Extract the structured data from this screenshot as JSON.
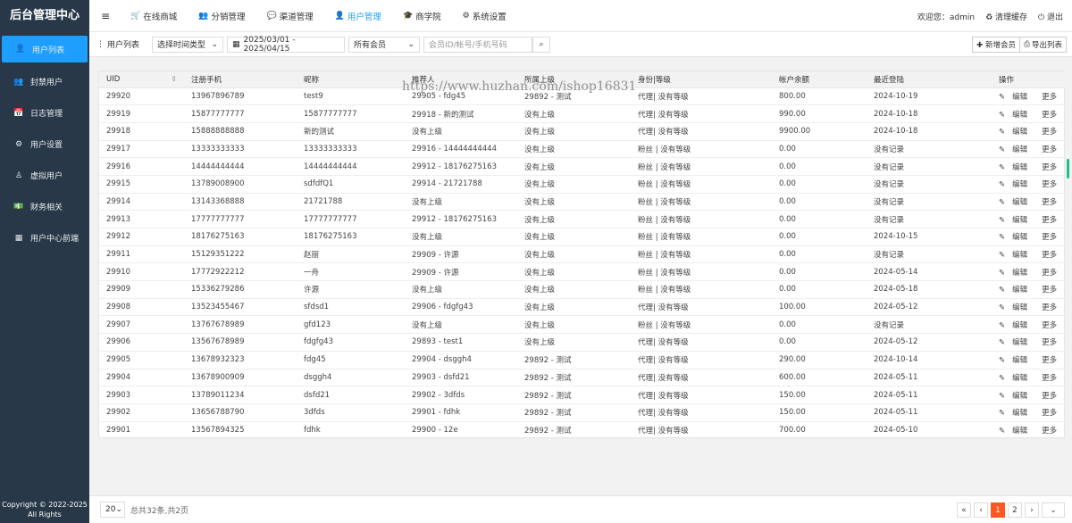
{
  "sidebar": {
    "brand": "后台管理中心",
    "items": [
      {
        "label": "用户列表",
        "icon": "user-icon",
        "glyph": "👤",
        "active": true
      },
      {
        "label": "封禁用户",
        "icon": "users-block-icon",
        "glyph": "👥"
      },
      {
        "label": "日志管理",
        "icon": "calendar-icon",
        "glyph": "📅"
      },
      {
        "label": "用户设置",
        "icon": "gear-icon",
        "glyph": "⚙"
      },
      {
        "label": "虚拟用户",
        "icon": "user-outline-icon",
        "glyph": "♙"
      },
      {
        "label": "财务相关",
        "icon": "money-icon",
        "glyph": "💵"
      },
      {
        "label": "用户中心前端",
        "icon": "grid-icon",
        "glyph": "▦"
      }
    ],
    "copyright_line1": "Copyright © 2022-2025",
    "copyright_line2": "All Rights"
  },
  "topnav": {
    "menu_glyph": "≡",
    "items": [
      {
        "label": "在线商城",
        "icon": "cart-icon",
        "glyph": "🛒"
      },
      {
        "label": "分销管理",
        "icon": "users-icon",
        "glyph": "👥"
      },
      {
        "label": "渠道管理",
        "icon": "chat-icon",
        "glyph": "💬"
      },
      {
        "label": "用户管理",
        "icon": "user-icon",
        "glyph": "👤",
        "active": true
      },
      {
        "label": "商学院",
        "icon": "graduation-cap-icon",
        "glyph": "🎓"
      },
      {
        "label": "系统设置",
        "icon": "gear-icon",
        "glyph": "⚙"
      }
    ],
    "welcome": "欢迎您：admin",
    "clear_cache": "♻ 清理缓存",
    "logout": "⏻ 退出"
  },
  "toolbar": {
    "title": "用户列表",
    "time_type": "选择时间类型",
    "date_range": "2025/03/01 - 2025/04/15",
    "member_type": "所有会员",
    "search_placeholder": "会员ID/帐号/手机号码",
    "add_member": "✚ 新增会员",
    "export": "导出列表"
  },
  "table": {
    "columns": [
      "UID",
      "注册手机",
      "昵称",
      "推荐人",
      "所属上级",
      "身份|等级",
      "帐户余额",
      "最近登陆",
      "操作"
    ],
    "edit_label": "编辑",
    "more_label": "更多",
    "rows": [
      [
        "29920",
        "13967896789",
        "test9",
        "29905 - fdg45",
        "29892 - 测试",
        "代理| 没有等级",
        "800.00",
        "2024-10-19"
      ],
      [
        "29919",
        "15877777777",
        "15877777777",
        "29918 - 新的测试",
        "没有上级",
        "代理| 没有等级",
        "990.00",
        "2024-10-18"
      ],
      [
        "29918",
        "15888888888",
        "新的测试",
        "没有上级",
        "没有上级",
        "代理| 没有等级",
        "9900.00",
        "2024-10-18"
      ],
      [
        "29917",
        "13333333333",
        "13333333333",
        "29916 - 14444444444",
        "没有上级",
        "粉丝 | 没有等级",
        "0.00",
        "没有记录"
      ],
      [
        "29916",
        "14444444444",
        "14444444444",
        "29912 - 18176275163",
        "没有上级",
        "粉丝 | 没有等级",
        "0.00",
        "没有记录"
      ],
      [
        "29915",
        "13789008900",
        "sdfdfQ1",
        "29914 - 21721788",
        "没有上级",
        "粉丝 | 没有等级",
        "0.00",
        "没有记录"
      ],
      [
        "29914",
        "13143368888",
        "21721788",
        "没有上级",
        "没有上级",
        "粉丝 | 没有等级",
        "0.00",
        "没有记录"
      ],
      [
        "29913",
        "17777777777",
        "17777777777",
        "29912 - 18176275163",
        "没有上级",
        "粉丝 | 没有等级",
        "0.00",
        "没有记录"
      ],
      [
        "29912",
        "18176275163",
        "18176275163",
        "没有上级",
        "没有上级",
        "粉丝 | 没有等级",
        "0.00",
        "2024-10-15"
      ],
      [
        "29911",
        "15129351222",
        "赵丽",
        "29909 - 许源",
        "没有上级",
        "粉丝 | 没有等级",
        "0.00",
        "没有记录"
      ],
      [
        "29910",
        "17772922212",
        "一舟",
        "29909 - 许源",
        "没有上级",
        "粉丝 | 没有等级",
        "0.00",
        "2024-05-14"
      ],
      [
        "29909",
        "15336279286",
        "许源",
        "没有上级",
        "没有上级",
        "粉丝 | 没有等级",
        "0.00",
        "2024-05-18"
      ],
      [
        "29908",
        "13523455467",
        "sfdsd1",
        "29906 - fdgfg43",
        "没有上级",
        "代理| 没有等级",
        "100.00",
        "2024-05-12"
      ],
      [
        "29907",
        "13767678989",
        "gfd123",
        "没有上级",
        "没有上级",
        "粉丝 | 没有等级",
        "0.00",
        "没有记录"
      ],
      [
        "29906",
        "13567678989",
        "fdgfg43",
        "29893 - test1",
        "没有上级",
        "代理| 没有等级",
        "0.00",
        "2024-05-12"
      ],
      [
        "29905",
        "13678932323",
        "fdg45",
        "29904 - dsggh4",
        "29892 - 测试",
        "代理| 没有等级",
        "290.00",
        "2024-10-14"
      ],
      [
        "29904",
        "13678900909",
        "dsggh4",
        "29903 - dsfd21",
        "29892 - 测试",
        "代理| 没有等级",
        "600.00",
        "2024-05-11"
      ],
      [
        "29903",
        "13789011234",
        "dsfd21",
        "29902 - 3dfds",
        "29892 - 测试",
        "代理| 没有等级",
        "150.00",
        "2024-05-11"
      ],
      [
        "29902",
        "13656788790",
        "3dfds",
        "29901 - fdhk",
        "29892 - 测试",
        "代理| 没有等级",
        "150.00",
        "2024-05-11"
      ],
      [
        "29901",
        "13567894325",
        "fdhk",
        "29900 - 12e",
        "29892 - 测试",
        "代理| 没有等级",
        "700.00",
        "2024-05-10"
      ]
    ]
  },
  "footer": {
    "page_size": "20",
    "summary": "总共32条,共2页",
    "pages": [
      "«",
      "‹",
      "1",
      "2",
      "›"
    ],
    "current": "1"
  },
  "watermark": "https://www.huzhan.com/ishop16831"
}
